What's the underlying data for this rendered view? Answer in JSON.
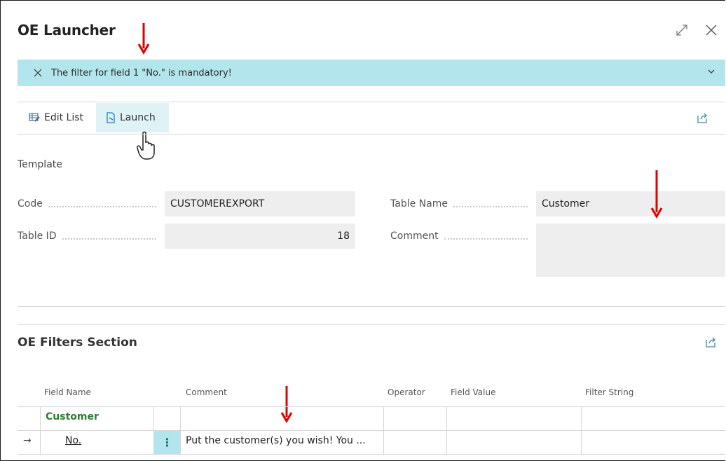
{
  "window": {
    "title": "OE Launcher"
  },
  "banner": {
    "message": "The filter for field 1 \"No.\" is mandatory!"
  },
  "toolbar": {
    "edit_list_label": "Edit List",
    "launch_label": "Launch"
  },
  "template": {
    "section_label": "Template",
    "code_label": "Code",
    "code_value": "CUSTOMEREXPORT",
    "table_id_label": "Table ID",
    "table_id_value": "18",
    "table_name_label": "Table Name",
    "table_name_value": "Customer",
    "comment_label": "Comment",
    "comment_value": ""
  },
  "filters": {
    "section_title": "OE Filters Section",
    "columns": [
      "Field Name",
      "Comment",
      "Operator",
      "Field Value",
      "Filter String"
    ],
    "rows": [
      {
        "field_name": "Customer",
        "comment": "",
        "operator": "",
        "field_value": "",
        "filter_string": ""
      },
      {
        "field_name": "No.",
        "comment": "Put the customer(s) you wish! You ...",
        "operator": "",
        "field_value": "",
        "filter_string": ""
      }
    ],
    "row_marker": "→",
    "menu_glyph": "⋮"
  },
  "colors": {
    "banner_bg": "#b3e6ec",
    "accent_green": "#2e7d32",
    "link_teal": "#00838f",
    "arrow_red": "#e00000"
  }
}
